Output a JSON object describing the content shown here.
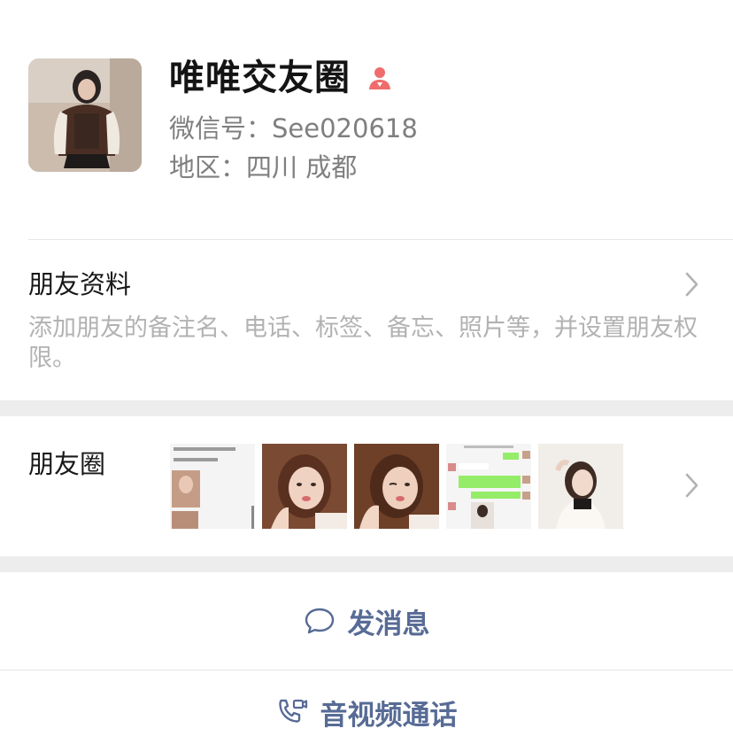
{
  "profile": {
    "name": "唯唯交友圈",
    "gender_icon": "female-icon",
    "wechat_id": "微信号：See020618",
    "region": "地区：四川 成都"
  },
  "friend_profile": {
    "title": "朋友资料",
    "description": "添加朋友的备注名、电话、标签、备忘、照片等，并设置朋友权限。"
  },
  "moments": {
    "title": "朋友圈",
    "thumb_count": 5
  },
  "actions": {
    "message": "发消息",
    "video_call": "音视频通话"
  },
  "colors": {
    "link_blue": "#576b95",
    "gender_pink": "#f06c6c",
    "gap_gray": "#ededed",
    "secondary_text": "#7f7f7f",
    "hint_text": "#b2b2b2"
  }
}
